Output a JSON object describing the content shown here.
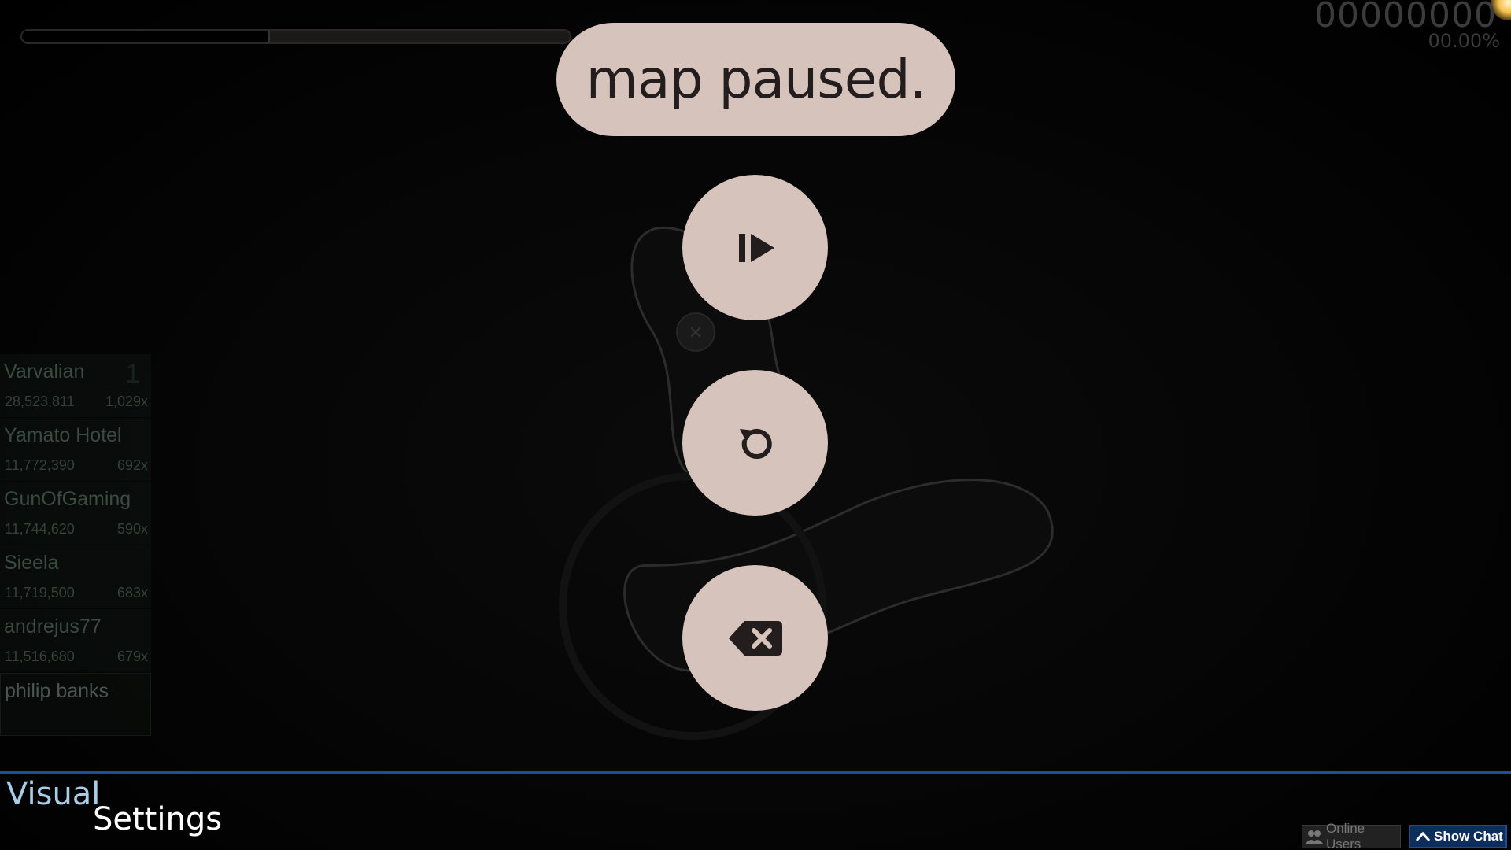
{
  "game": {
    "progress_fraction": 0.45,
    "score": "00000000",
    "accuracy": "00.00%"
  },
  "pause_menu": {
    "title": "map paused.",
    "buttons": [
      {
        "action": "continue",
        "icon": "play-pause-icon"
      },
      {
        "action": "retry",
        "icon": "retry-icon"
      },
      {
        "action": "quit",
        "icon": "backspace-x-icon"
      }
    ]
  },
  "leaderboard": {
    "entries": [
      {
        "name": "Varvalian",
        "rank": "1",
        "score": "28,523,811",
        "combo": "1,029x"
      },
      {
        "name": "Yamato Hotel",
        "rank": "",
        "score": "11,772,390",
        "combo": "692x"
      },
      {
        "name": "GunOfGaming",
        "rank": "",
        "score": "11,744,620",
        "combo": "590x"
      },
      {
        "name": "Sieela",
        "rank": "",
        "score": "11,719,500",
        "combo": "683x"
      },
      {
        "name": "andrejus77",
        "rank": "",
        "score": "11,516,680",
        "combo": "679x"
      }
    ],
    "self": {
      "name": "philip banks"
    }
  },
  "footer": {
    "visual_label": "Visual",
    "settings_label": "Settings",
    "online_users_label": "Online Users",
    "show_chat_label": "Show Chat"
  },
  "colors": {
    "pill": "#d6c4bc",
    "pill_text": "#241d1d",
    "accent_blue": "#1c4f9a"
  }
}
